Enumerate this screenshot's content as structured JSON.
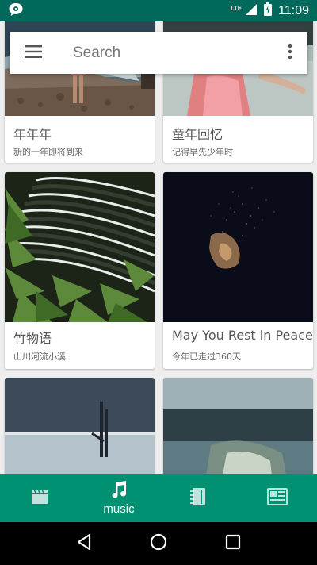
{
  "status_bar": {
    "network": "LTE",
    "time": "11:09"
  },
  "search": {
    "placeholder": "Search"
  },
  "cards": [
    {
      "title": "年年年",
      "subtitle": "新的一年即将到来"
    },
    {
      "title": "童年回忆",
      "subtitle": "记得早先少年时"
    },
    {
      "title": "竹物语",
      "subtitle": "山川河流小溪"
    },
    {
      "title": "May You Rest in Peace",
      "subtitle": "今年已走过360天"
    },
    {
      "title": "",
      "subtitle": ""
    },
    {
      "title": "",
      "subtitle": ""
    }
  ],
  "bottom_nav": {
    "items": [
      {
        "icon": "movie-icon",
        "label": ""
      },
      {
        "icon": "music-icon",
        "label": "music"
      },
      {
        "icon": "book-icon",
        "label": ""
      },
      {
        "icon": "newspaper-icon",
        "label": ""
      }
    ],
    "active_index": 1
  },
  "colors": {
    "status_bar": "#00695c",
    "bottom_nav": "#009173",
    "background": "#eeeeee"
  }
}
